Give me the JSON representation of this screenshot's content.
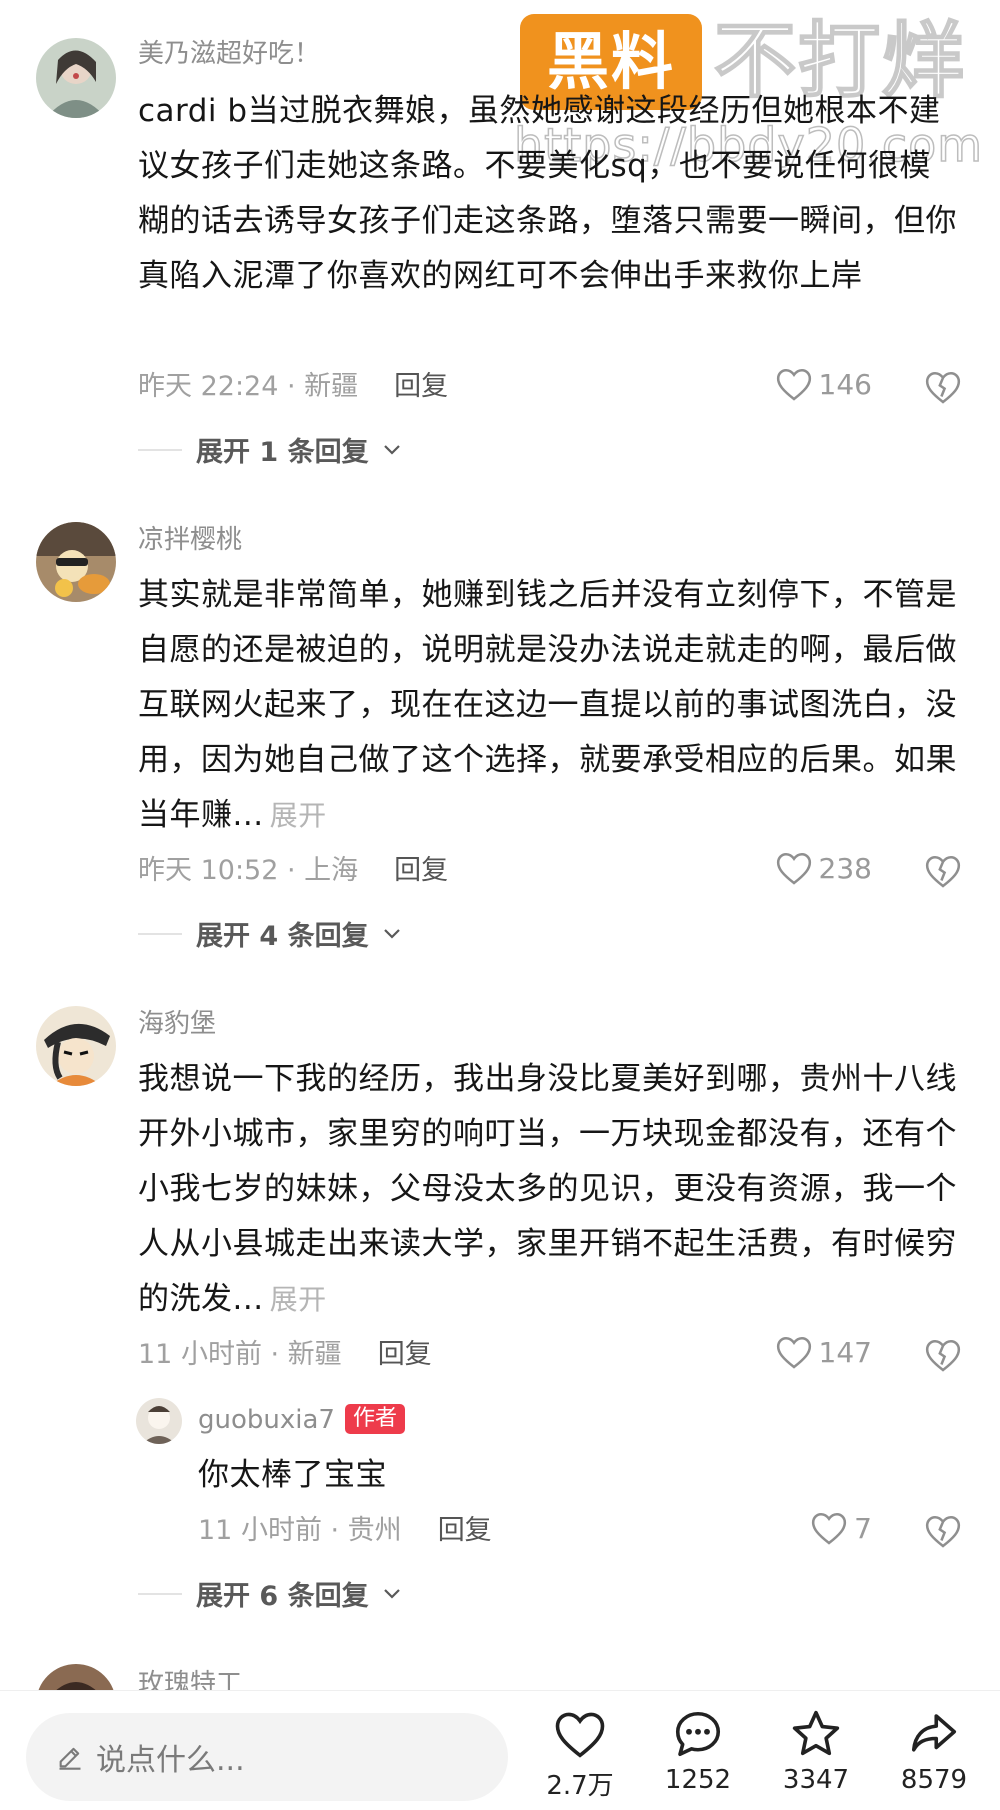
{
  "watermark": {
    "badge": "黑料",
    "title": "不打烊",
    "url": "https://bbdy20.com"
  },
  "comments": [
    {
      "user": "美乃滋超好吃！",
      "text": "cardi b当过脱衣舞娘，虽然她感谢这段经历但她根本不建议女孩子们走她这条路。不要美化sq，也不要说任何很模糊的话去诱导女孩子们走这条路，堕落只需要一瞬间，但你真陷入泥潭了你喜欢的网红可不会伸出手来救你上岸",
      "meta": "昨天 22:24 · 新疆",
      "reply_label": "回复",
      "likes": "146",
      "expand_replies": "展开 1 条回复"
    },
    {
      "user": "凉拌樱桃",
      "text": "其实就是非常简单，她赚到钱之后并没有立刻停下，不管是自愿的还是被迫的，说明就是没办法说走就走的啊，最后做互联网火起来了，现在在这边一直提以前的事试图洗白，没用，因为她自己做了这个选择，就要承受相应的后果。如果当年赚...",
      "expand": "展开",
      "meta": "昨天 10:52 · 上海",
      "reply_label": "回复",
      "likes": "238",
      "expand_replies": "展开 4 条回复"
    },
    {
      "user": "海豹堡",
      "text": "我想说一下我的经历，我出身没比夏美好到哪，贵州十八线开外小城市，家里穷的响叮当，一万块现金都没有，还有个小我七岁的妹妹，父母没太多的见识，更没有资源，我一个人从小县城走出来读大学，家里开销不起生活费，有时候穷的洗发...",
      "expand": "展开",
      "meta": "11 小时前 · 新疆",
      "reply_label": "回复",
      "likes": "147",
      "reply": {
        "user": "guobuxia7",
        "tag": "作者",
        "text": "你太棒了宝宝",
        "meta": "11 小时前 · 贵州",
        "reply_label": "回复",
        "likes": "7"
      },
      "expand_replies": "展开 6 条回复"
    },
    {
      "user": "玫瑰特工"
    }
  ],
  "bottom_bar": {
    "placeholder": "说点什么...",
    "likes": "2.7万",
    "comments": "1252",
    "favorites": "3347",
    "shares": "8579"
  },
  "colors": {
    "author_tag": "#ee3b4b",
    "watermark_badge": "#f0921e"
  }
}
